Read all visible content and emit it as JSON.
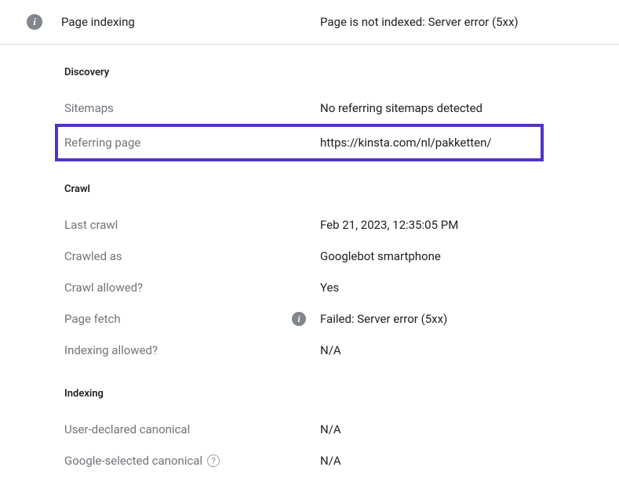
{
  "header": {
    "title": "Page indexing",
    "status": "Page is not indexed: Server error (5xx)"
  },
  "discovery": {
    "heading": "Discovery",
    "sitemaps_label": "Sitemaps",
    "sitemaps_value": "No referring sitemaps detected",
    "referring_label": "Referring page",
    "referring_value": "https://kinsta.com/nl/pakketten/"
  },
  "crawl": {
    "heading": "Crawl",
    "last_crawl_label": "Last crawl",
    "last_crawl_value": "Feb 21, 2023, 12:35:05 PM",
    "crawled_as_label": "Crawled as",
    "crawled_as_value": "Googlebot smartphone",
    "crawl_allowed_label": "Crawl allowed?",
    "crawl_allowed_value": "Yes",
    "page_fetch_label": "Page fetch",
    "page_fetch_value": "Failed: Server error (5xx)",
    "indexing_allowed_label": "Indexing allowed?",
    "indexing_allowed_value": "N/A"
  },
  "indexing": {
    "heading": "Indexing",
    "user_canonical_label": "User-declared canonical",
    "user_canonical_value": "N/A",
    "google_canonical_label": "Google-selected canonical",
    "google_canonical_value": "N/A"
  }
}
